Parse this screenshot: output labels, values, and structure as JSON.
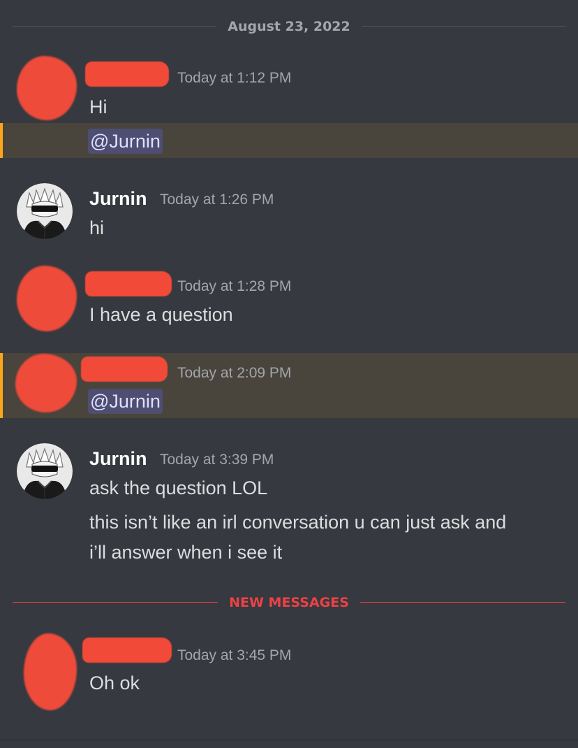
{
  "date_divider": "August 23, 2022",
  "new_messages_label": "NEW MESSAGES",
  "messages": [
    {
      "username": "",
      "timestamp": "Today at 1:12 PM",
      "text": "Hi",
      "mention": "@Jurnin"
    },
    {
      "username": "Jurnin",
      "timestamp": "Today at 1:26 PM",
      "text": "hi"
    },
    {
      "username": "",
      "timestamp": "Today at 1:28 PM",
      "text": "I have a question"
    },
    {
      "username": "",
      "timestamp": "Today at 2:09 PM",
      "mention": "@Jurnin"
    },
    {
      "username": "Jurnin",
      "timestamp": "Today at 3:39 PM",
      "text": "ask the question LOL",
      "text2": "this isn’t like an irl conversation u can just ask and",
      "text3": "i’ll answer when i see it"
    },
    {
      "username": "",
      "timestamp": "Today at 3:45 PM",
      "text": "Oh ok"
    }
  ],
  "colors": {
    "background": "#36393f",
    "mention_highlight": "#49443c",
    "mention_bar": "#faa61a",
    "new_messages": "#ed4245",
    "redaction": "#ef4b3b"
  }
}
